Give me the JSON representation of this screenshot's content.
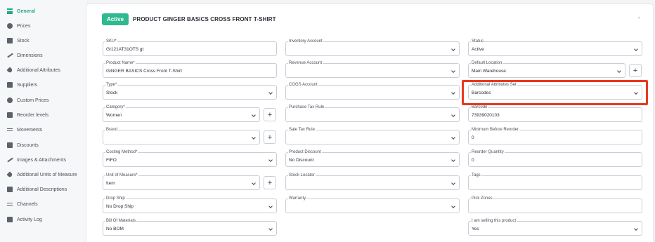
{
  "sidebar": {
    "items": [
      {
        "label": "General",
        "icon": "list-icon",
        "active": true
      },
      {
        "label": "Prices",
        "icon": "coin-icon"
      },
      {
        "label": "Stock",
        "icon": "warehouse-icon"
      },
      {
        "label": "Dimensions",
        "icon": "ruler-icon"
      },
      {
        "label": "Additional Attributes",
        "icon": "tag-icon"
      },
      {
        "label": "Suppliers",
        "icon": "cart-icon"
      },
      {
        "label": "Custom Prices",
        "icon": "coin-icon"
      },
      {
        "label": "Reorder levels",
        "icon": "truck-icon"
      },
      {
        "label": "Movements",
        "icon": "arrows-icon"
      },
      {
        "label": "Discounts",
        "icon": "lock-icon"
      },
      {
        "label": "Images & Attachments",
        "icon": "paperclip-icon"
      },
      {
        "label": "Additional Units of Measure",
        "icon": "tools-icon"
      },
      {
        "label": "Additional Descriptions",
        "icon": "document-icon"
      },
      {
        "label": "Channels",
        "icon": "branch-icon"
      },
      {
        "label": "Activity Log",
        "icon": "flag-icon"
      }
    ]
  },
  "header": {
    "status_badge": "Active",
    "title": "PRODUCT GINGER BASICS CROSS FRONT T-SHIRT",
    "collapse": "^"
  },
  "fields": {
    "sku": {
      "label": "SKU*",
      "value": "GI121AT31OTS gt"
    },
    "product_name": {
      "label": "Product Name*",
      "value": "GINGER BASICS Cross Front T-Shirt"
    },
    "type": {
      "label": "Type*",
      "value": "Stock"
    },
    "category": {
      "label": "Category*",
      "value": "Women"
    },
    "brand": {
      "label": "Brand",
      "value": ""
    },
    "costing_method": {
      "label": "Costing Method*",
      "value": "FIFO"
    },
    "unit_of_measure": {
      "label": "Unit of Measure*",
      "value": "Item"
    },
    "drop_ship": {
      "label": "Drop Ship",
      "value": "No Drop Ship"
    },
    "bill_of_materials": {
      "label": "Bill Of Materials",
      "value": "No BOM"
    },
    "inventory_account": {
      "label": "Inventory Account",
      "value": ""
    },
    "revenue_account": {
      "label": "Revenue Account",
      "value": ""
    },
    "cogs_account": {
      "label": "COGS Account",
      "value": ""
    },
    "purchase_tax_rule": {
      "label": "Purchase Tax Rule",
      "value": ""
    },
    "sale_tax_rule": {
      "label": "Sale Tax Rule",
      "value": ""
    },
    "product_discount": {
      "label": "Product Discount",
      "value": "No Discount"
    },
    "stock_locator": {
      "label": "Stock Locator",
      "value": ""
    },
    "warranty": {
      "label": "Warranty",
      "value": ""
    },
    "status": {
      "label": "Status",
      "value": "Active"
    },
    "default_location": {
      "label": "Default Location",
      "value": "Main Warehouse"
    },
    "additional_attributes_set": {
      "label": "Additional Attributes Set",
      "value": "Barcodes"
    },
    "barcode": {
      "label": "Barcode",
      "value": "73939020103"
    },
    "minimum_before_reorder": {
      "label": "Minimum Before Reorder",
      "value": "0"
    },
    "reorder_quantity": {
      "label": "Reorder Quantity",
      "value": "0"
    },
    "tags": {
      "label": "Tags",
      "value": ""
    },
    "pick_zones": {
      "label": "Pick Zones",
      "value": ""
    },
    "selling_product": {
      "label": "I am selling this product",
      "value": "Yes"
    }
  },
  "plus_label": "+",
  "colors": {
    "accent": "#22a989",
    "badge": "#2fb98f",
    "highlight": "#e8391c"
  }
}
